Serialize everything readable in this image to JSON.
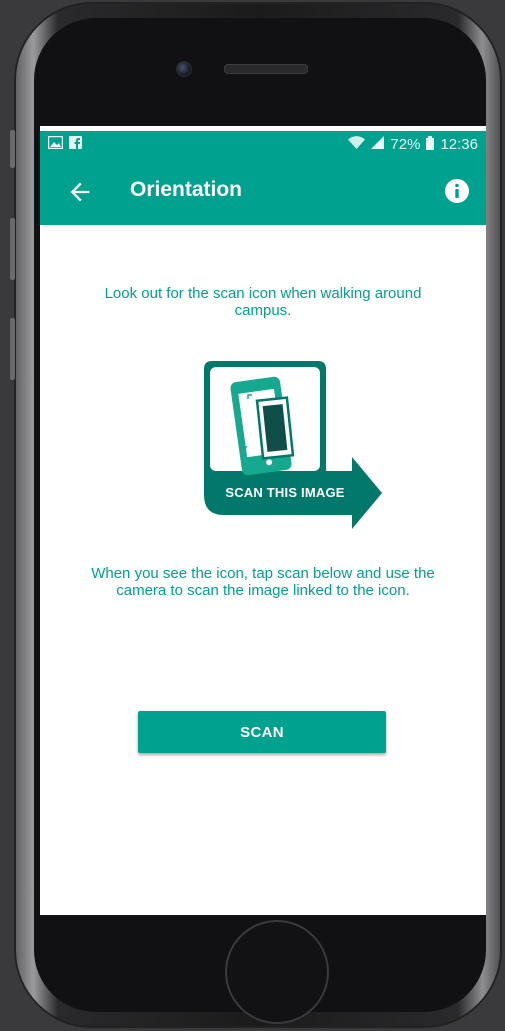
{
  "status_bar": {
    "battery": "72%",
    "time": "12:36"
  },
  "app_bar": {
    "title": "Orientation"
  },
  "main": {
    "intro_text": "Look out for the scan icon when walking around campus.",
    "scan_image_label": "SCAN THIS IMAGE",
    "instruction_text": "When you see the icon, tap scan below and use the camera to scan the image linked to the icon.",
    "scan_button_label": "SCAN"
  },
  "icons": [
    "image-notification-icon",
    "facebook-notification-icon",
    "wifi-icon",
    "signal-icon",
    "battery-icon",
    "back-arrow-icon",
    "info-icon"
  ],
  "colors": {
    "primary": "#00a18e",
    "primary_dark": "#00796b",
    "background": "#ffffff"
  }
}
